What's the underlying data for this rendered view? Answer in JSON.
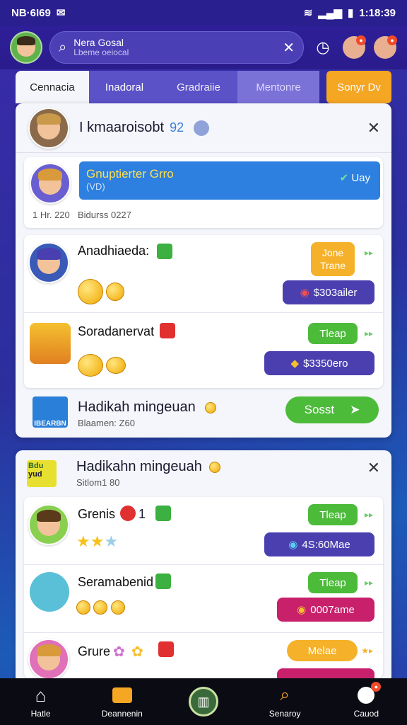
{
  "status": {
    "left": "NB·6I69",
    "time": "1:18:39"
  },
  "search": {
    "line1": "Nera Gosal",
    "line2": "Lbeme oeiocal"
  },
  "tabs": [
    "Cennacia",
    "Inadoral",
    "Gradraiie",
    "Mentonre",
    "Sonyr Dv"
  ],
  "header": {
    "title": "I kmaaroisobt",
    "count": "92"
  },
  "featured": {
    "banner_title": "Gnuptierter Grro",
    "banner_sub": "(VD)",
    "banner_action": "Uay",
    "left_label": "1 Hr. 220",
    "right_label": "Bidurss 0227"
  },
  "group1": {
    "items": [
      {
        "name": "Anadhiaeda:",
        "action": "Jone Trane",
        "price": "$303ailer"
      },
      {
        "name": "Soradanervat",
        "action": "Tleap",
        "price": "$3350ero"
      }
    ],
    "footer_title": "Hadikah mingeuan",
    "footer_sub": "Blaamen: Z60",
    "footer_action": "Sosst",
    "footer_logo": "IBEARBN"
  },
  "section2": {
    "title": "Hadikahn mingeuah",
    "sub": "Sitlom1 80",
    "logo_line1": "Bdu",
    "logo_line2": "yud",
    "items": [
      {
        "name": "Grenis",
        "badge": "1",
        "action": "Tleap",
        "price": "4S:60Mae"
      },
      {
        "name": "Seramabenid",
        "action": "Tleap",
        "price": "0007ame"
      },
      {
        "name": "Grure",
        "action": "Melae",
        "price": ""
      }
    ]
  },
  "nav": [
    "Hatle",
    "Deannenin",
    "",
    "Senaroy",
    "Cauod"
  ],
  "colors": {
    "accent": "#4b3fb0",
    "green": "#4cbb3a",
    "orange": "#f5b12a",
    "magenta": "#c8206a",
    "banner": "#2d7fe0"
  }
}
